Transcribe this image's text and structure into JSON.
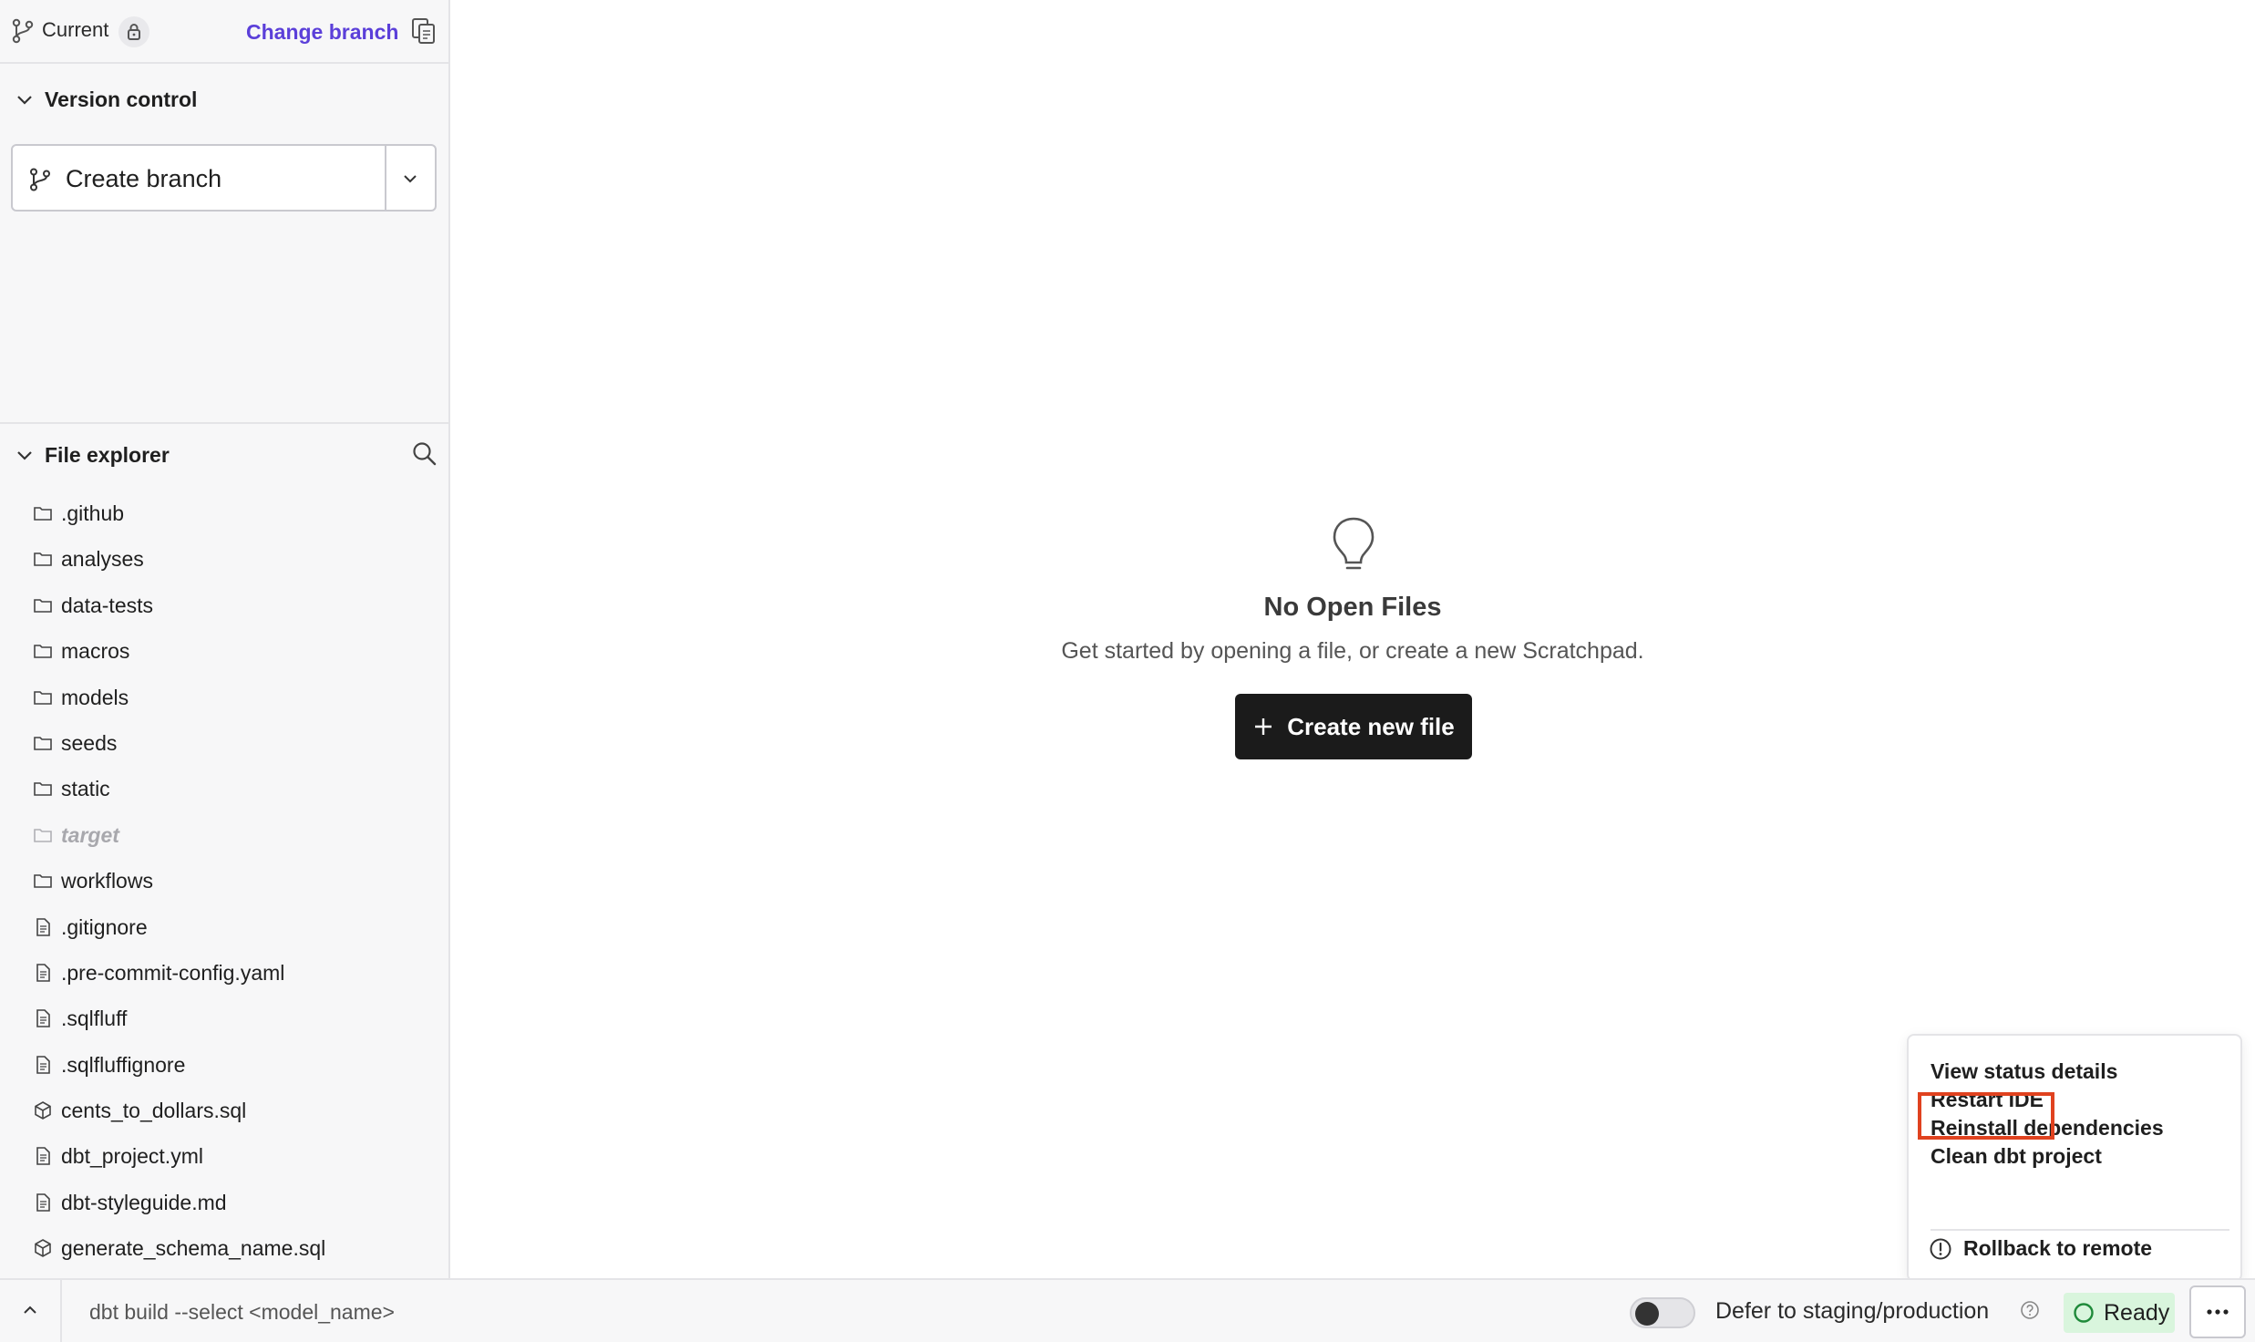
{
  "branch": {
    "current_label": "Current",
    "change_branch_label": "Change branch"
  },
  "version_control": {
    "title": "Version control",
    "create_branch_label": "Create branch"
  },
  "file_explorer": {
    "title": "File explorer",
    "items": [
      {
        "name": ".github",
        "type": "folder"
      },
      {
        "name": "analyses",
        "type": "folder"
      },
      {
        "name": "data-tests",
        "type": "folder"
      },
      {
        "name": "macros",
        "type": "folder"
      },
      {
        "name": "models",
        "type": "folder"
      },
      {
        "name": "seeds",
        "type": "folder"
      },
      {
        "name": "static",
        "type": "folder"
      },
      {
        "name": "target",
        "type": "folder-muted"
      },
      {
        "name": "workflows",
        "type": "folder"
      },
      {
        "name": ".gitignore",
        "type": "file"
      },
      {
        "name": ".pre-commit-config.yaml",
        "type": "file"
      },
      {
        "name": ".sqlfluff",
        "type": "file"
      },
      {
        "name": ".sqlfluffignore",
        "type": "file"
      },
      {
        "name": "cents_to_dollars.sql",
        "type": "model"
      },
      {
        "name": "dbt_project.yml",
        "type": "file"
      },
      {
        "name": "dbt-styleguide.md",
        "type": "file"
      },
      {
        "name": "generate_schema_name.sql",
        "type": "model"
      }
    ]
  },
  "empty_state": {
    "title": "No Open Files",
    "subtitle": "Get started by opening a file, or create a new Scratchpad.",
    "create_button_label": "Create new file"
  },
  "bottom_bar": {
    "command_placeholder": "dbt build --select <model_name>",
    "defer_label": "Defer to staging/production",
    "defer_enabled": false,
    "status_label": "Ready"
  },
  "menu": {
    "items": [
      "View status details",
      "Restart IDE",
      "Reinstall dependencies",
      "Clean dbt project"
    ],
    "rollback_label": "Rollback to remote",
    "highlighted_item": "Restart IDE",
    "highlight_color": "#e0421f"
  },
  "colors": {
    "accent": "#5b3fd9",
    "ready_bg": "#d9f5dd",
    "ready_ring": "#1f8a3a"
  }
}
